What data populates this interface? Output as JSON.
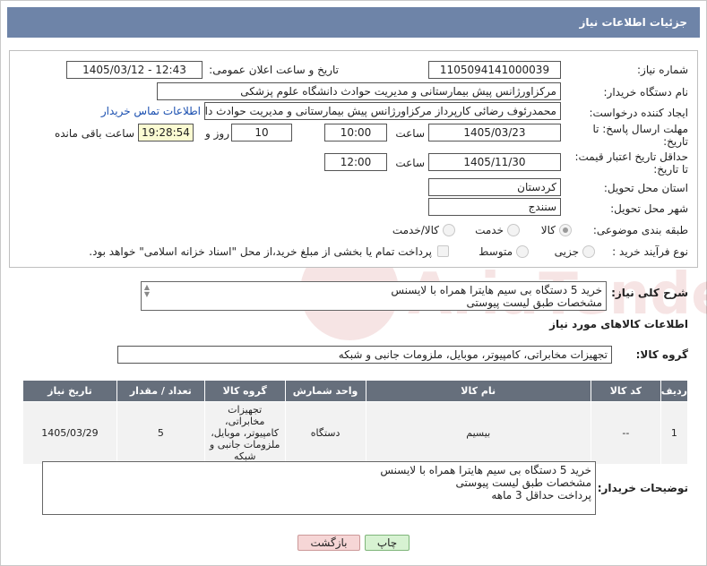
{
  "header": {
    "title": "جزئیات اطلاعات نیاز"
  },
  "form": {
    "need_number": {
      "label": "شماره نیاز:",
      "value": "1105094141000039"
    },
    "announce_datetime": {
      "label": "تاریخ و ساعت اعلان عمومی:",
      "value": "1405/03/12 - 12:43"
    },
    "buyer_org": {
      "label": "نام دستگاه خریدار:",
      "value": "مرکزاورژانس پیش بیمارستانی و مدیریت حوادث دانشگاه علوم پزشکی"
    },
    "creator": {
      "label": "ایجاد کننده درخواست:",
      "value": "محمدرئوف رضائی کارپرداز مرکزاورژانس پیش بیمارستانی و مدیریت حوادث دانشگ",
      "contact_link": "اطلاعات تماس خریدار"
    },
    "reply_deadline": {
      "label_line1": "مهلت ارسال پاسخ: تا",
      "label_line2": "تاریخ:",
      "date": "1405/03/23",
      "time_label": "ساعت",
      "time": "10:00",
      "days": "10",
      "days_label": "روز و",
      "remaining": "19:28:54",
      "remaining_label": "ساعت باقی مانده"
    },
    "price_validity": {
      "label_line1": "حداقل تاریخ اعتبار قیمت:",
      "label_line2": "تا تاریخ:",
      "date": "1405/11/30",
      "time_label": "ساعت",
      "time": "12:00"
    },
    "province": {
      "label": "استان محل تحویل:",
      "value": "کردستان"
    },
    "city": {
      "label": "شهر محل تحویل:",
      "value": "سنندج"
    },
    "category": {
      "label": "طبقه بندی موضوعی:",
      "options": [
        "کالا",
        "خدمت",
        "کالا/خدمت"
      ],
      "selected": "کالا"
    },
    "purchase_type": {
      "label": "نوع فرآیند خرید :",
      "options": [
        "جزیی",
        "متوسط"
      ],
      "selected": "",
      "note": "پرداخت تمام یا بخشی از مبلغ خرید،از محل \"اسناد خزانه اسلامی\" خواهد بود."
    }
  },
  "summary": {
    "label": "شرح کلی نیاز:",
    "lines": [
      "خرید 5 دستگاه بی سیم هایترا همراه با لایسنس",
      "مشخصات طبق لیست پیوستی"
    ]
  },
  "goods_info": {
    "title": "اطلاعات کالاهای مورد نیاز",
    "group_label": "گروه کالا:",
    "group_value": "تجهیزات مخابراتی، کامپیوتر، موبایل، ملزومات جانبی و شبکه"
  },
  "table": {
    "headers": [
      "ردیف",
      "کد کالا",
      "نام کالا",
      "واحد شمارش",
      "گروه کالا",
      "تعداد / مقدار",
      "تاریخ نیاز"
    ],
    "rows": [
      {
        "row": "1",
        "code": "--",
        "name": "بیسیم",
        "unit": "دستگاه",
        "group": "تجهیزات مخابراتی، کامپیوتر، موبایل، ملزومات جانبی و شبکه",
        "qty": "5",
        "date": "1405/03/29"
      }
    ]
  },
  "buyer_notes": {
    "label": "توضیحات خریدار:",
    "lines": [
      "خرید 5 دستگاه بی سیم هایترا همراه با لایسنس",
      "مشخصات طبق لیست پیوستی",
      "پرداخت حداقل 3 ماهه"
    ]
  },
  "buttons": {
    "print": "چاپ",
    "back": "بازگشت"
  },
  "watermark": {
    "text": "AriaTender.net"
  }
}
